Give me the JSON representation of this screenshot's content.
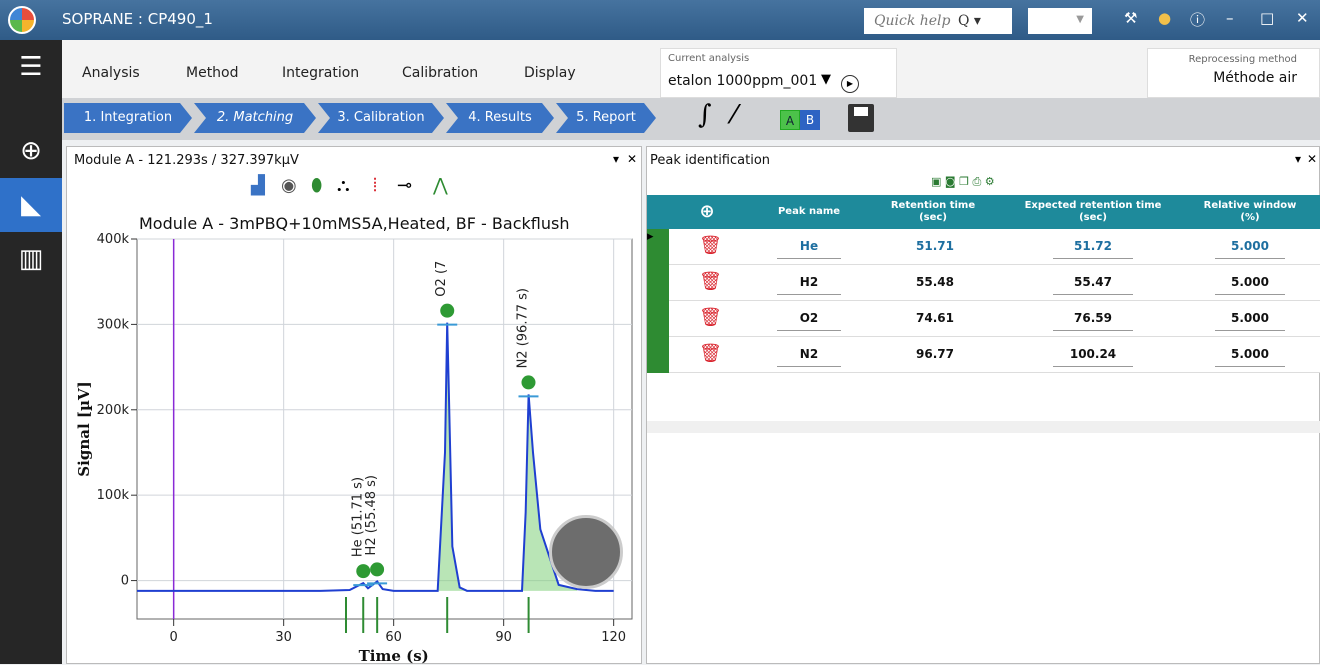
{
  "app": {
    "title": "SOPRANE : CP490_1",
    "quick_help": "Quick help",
    "search_glyph": "Q ▾"
  },
  "menu": [
    "Analysis",
    "Method",
    "Integration",
    "Calibration",
    "Display"
  ],
  "current_analysis": {
    "label": "Current analysis",
    "value": "etalon 1000ppm_001"
  },
  "reprocessing": {
    "label": "Reprocessing method",
    "value": "Méthode air"
  },
  "workflow": [
    "1. Integration",
    "2. Matching",
    "3. Calibration",
    "4. Results",
    "5. Report"
  ],
  "toolbar": {
    "a": "A",
    "b": "B"
  },
  "left_panel": {
    "title": "Module A - 121.293s / 327.397kµV",
    "chart_title": "Module A - 3mPBQ+10mMS5A,Heated, BF - Backflush"
  },
  "right_panel": {
    "title": "Peak identification"
  },
  "table": {
    "headers": [
      "Peak name",
      "Retention time (sec)",
      "Expected retention time (sec)",
      "Relative window (%)"
    ],
    "rows": [
      {
        "name": "He",
        "rt": "51.71",
        "expected": "51.72",
        "window": "5.000",
        "selected": true
      },
      {
        "name": "H2",
        "rt": "55.48",
        "expected": "55.47",
        "window": "5.000",
        "selected": false
      },
      {
        "name": "O2",
        "rt": "74.61",
        "expected": "76.59",
        "window": "5.000",
        "selected": false
      },
      {
        "name": "N2",
        "rt": "96.77",
        "expected": "100.24",
        "window": "5.000",
        "selected": false
      }
    ]
  },
  "chart_data": {
    "type": "line",
    "title": "Module A - 3mPBQ+10mMS5A,Heated, BF - Backflush",
    "xlabel": "Time (s)",
    "ylabel": "Signal [µV]",
    "xlim": [
      -10,
      125
    ],
    "ylim": [
      -45000,
      400000
    ],
    "xticks": [
      0,
      30,
      60,
      90,
      120
    ],
    "yticks": [
      {
        "v": 0,
        "label": "0"
      },
      {
        "v": 100000,
        "label": "100k"
      },
      {
        "v": 200000,
        "label": "200k"
      },
      {
        "v": 300000,
        "label": "300k"
      },
      {
        "v": 400000,
        "label": "400k"
      }
    ],
    "series": [
      {
        "x": [
          -10,
          0,
          40,
          48,
          51.7,
          53,
          55.5,
          57,
          60,
          72,
          74,
          74.6,
          75,
          76,
          78,
          80,
          95,
          96,
          96.8,
          98,
          100,
          105,
          110,
          115,
          120
        ],
        "y": [
          -12000,
          -12000,
          -12000,
          -11000,
          -3000,
          -9000,
          -1000,
          -10000,
          -12000,
          -12000,
          150000,
          302000,
          230000,
          40000,
          -8000,
          -12000,
          -12000,
          80000,
          218000,
          150000,
          60000,
          -5000,
          -10000,
          -12000,
          -12000
        ]
      }
    ],
    "annotations": [
      {
        "label": "He (51.71 s)",
        "x": 51.71
      },
      {
        "label": "H2 (55.48 s)",
        "x": 55.48
      },
      {
        "label": "O2 (7",
        "x": 74.61
      },
      {
        "label": "N2 (96.77 s)",
        "x": 96.77
      }
    ],
    "expected_markers": [
      47,
      51.7,
      55.5,
      74.6,
      96.8
    ]
  },
  "colors": {
    "accent": "#3a73c4",
    "trace": "#1f3fd1",
    "grid": "#d0d4da",
    "table_header": "#1e8a9b",
    "row_marker": "#2e8b32",
    "trash": "#d9262f",
    "peak_fill": "#7fcf7a"
  }
}
